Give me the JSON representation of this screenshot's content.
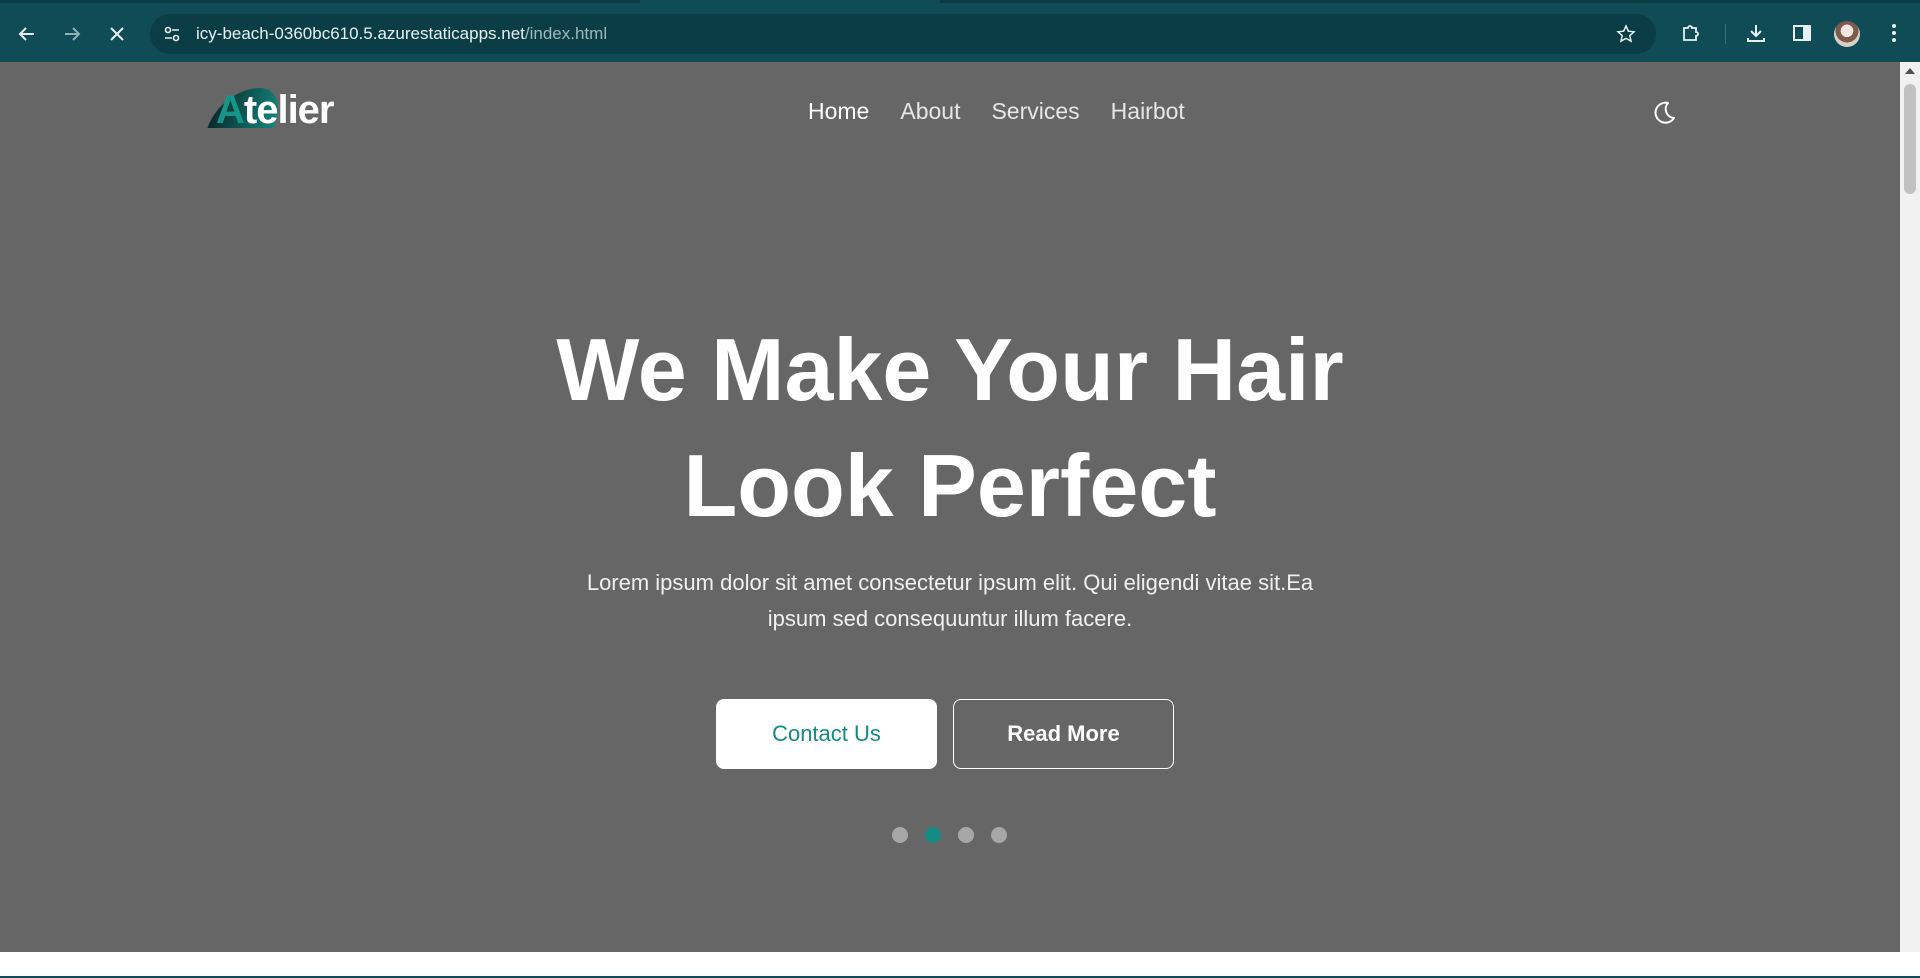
{
  "browser": {
    "url_host": "icy-beach-0360bc610.5.azurestaticapps.net",
    "url_path": "/index.html"
  },
  "site": {
    "logo_initial": "A",
    "logo_rest": "telier",
    "nav": [
      {
        "label": "Home",
        "active": true
      },
      {
        "label": "About",
        "active": false
      },
      {
        "label": "Services",
        "active": false
      },
      {
        "label": "Hairbot",
        "active": false
      }
    ]
  },
  "hero": {
    "title_line1": "We Make Your Hair",
    "title_line2": "Look Perfect",
    "subtitle_line1": "Lorem ipsum dolor sit amet consectetur ipsum elit. Qui eligendi vitae sit.Ea",
    "subtitle_line2": "ipsum sed consequuntur illum facere.",
    "contact_label": "Contact Us",
    "read_more_label": "Read More",
    "slides_total": 4,
    "active_slide": 2
  },
  "colors": {
    "accent": "#138a84",
    "hero_bg": "#666666",
    "chrome_bg": "#0f4c55"
  }
}
